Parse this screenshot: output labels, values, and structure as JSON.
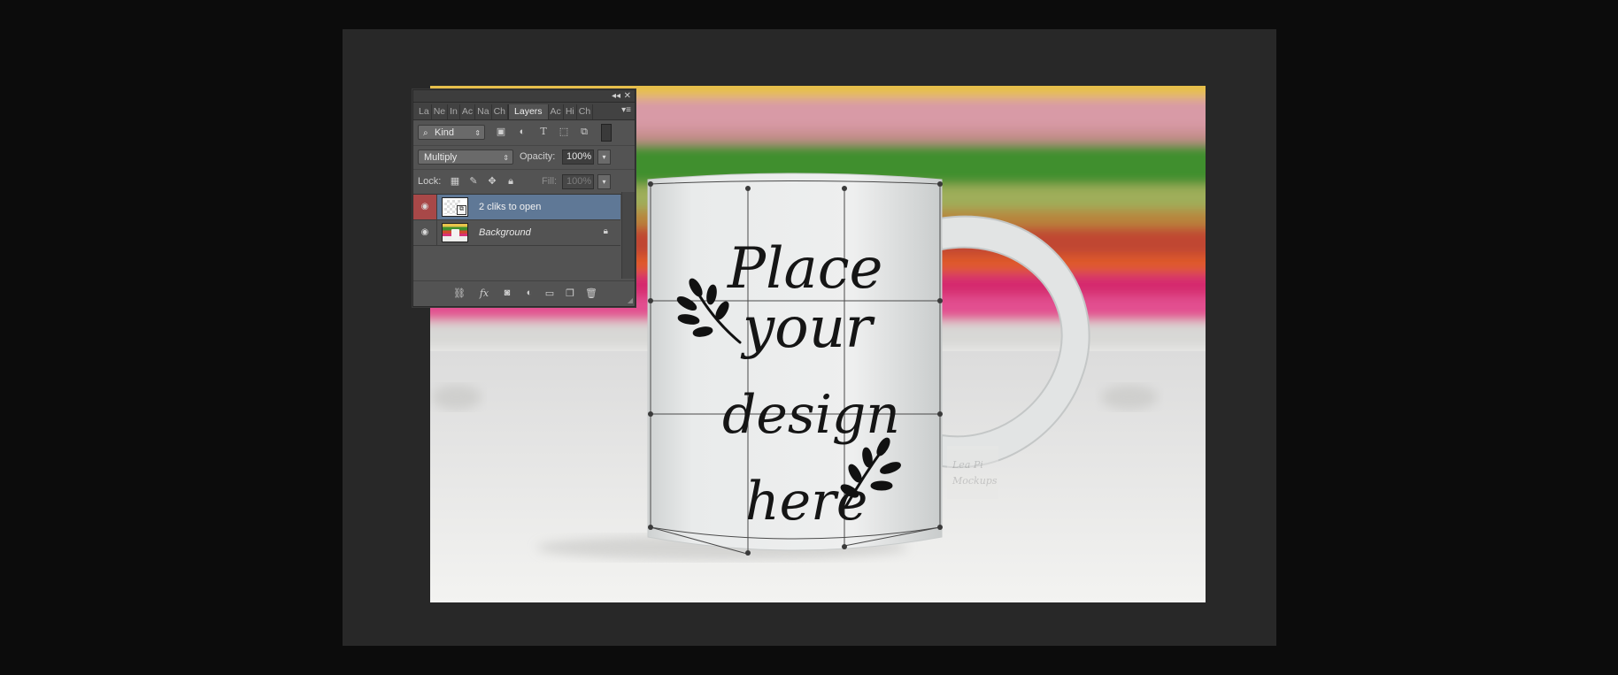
{
  "window": {
    "collapse_icon": "double-chevron-left-icon",
    "close_icon": "close-icon"
  },
  "tabs": [
    {
      "label": "La"
    },
    {
      "label": "Ne"
    },
    {
      "label": "In"
    },
    {
      "label": "Ac"
    },
    {
      "label": "Na"
    },
    {
      "label": "Ch"
    },
    {
      "label": "Layers",
      "active": true
    },
    {
      "label": "Ac"
    },
    {
      "label": "Hi"
    },
    {
      "label": "Ch"
    }
  ],
  "filter": {
    "kind_label": "Kind",
    "icons": [
      "image-filter-icon",
      "adjustment-filter-icon",
      "type-filter-icon",
      "shape-filter-icon",
      "smart-object-filter-icon",
      "filter-toggle-icon"
    ]
  },
  "blend": {
    "mode": "Multiply",
    "opacity_label": "Opacity:",
    "opacity_value": "100%"
  },
  "lock": {
    "label": "Lock:",
    "icons": [
      "lock-transparent-icon",
      "lock-pixels-icon",
      "lock-position-icon",
      "lock-all-icon"
    ],
    "fill_label": "Fill:",
    "fill_value": "100%"
  },
  "layers": [
    {
      "name": "2 cliks to open",
      "selected": true,
      "type": "smart-object"
    },
    {
      "name": "Background",
      "selected": false,
      "locked": true
    }
  ],
  "footer_icons": [
    "link-layers-icon",
    "fx-icon",
    "mask-icon",
    "adjustment-layer-icon",
    "group-folder-icon",
    "new-layer-icon",
    "trash-icon"
  ],
  "footer_fx_label": "fx",
  "canvas": {
    "mug_text": [
      "Place",
      "your",
      "design",
      "here"
    ],
    "watermark": [
      "Lea Pi",
      "Mockups"
    ],
    "colors": {
      "band_yellow": "#e8c24a",
      "band_pink_top": "#d99aa3",
      "band_green": "#4f9a3a",
      "band_olive": "#a9a34c",
      "band_orange": "#d4542e",
      "band_magenta": "#d8327a",
      "table": "#eeeeec",
      "mug": "#e4e6e6"
    }
  }
}
